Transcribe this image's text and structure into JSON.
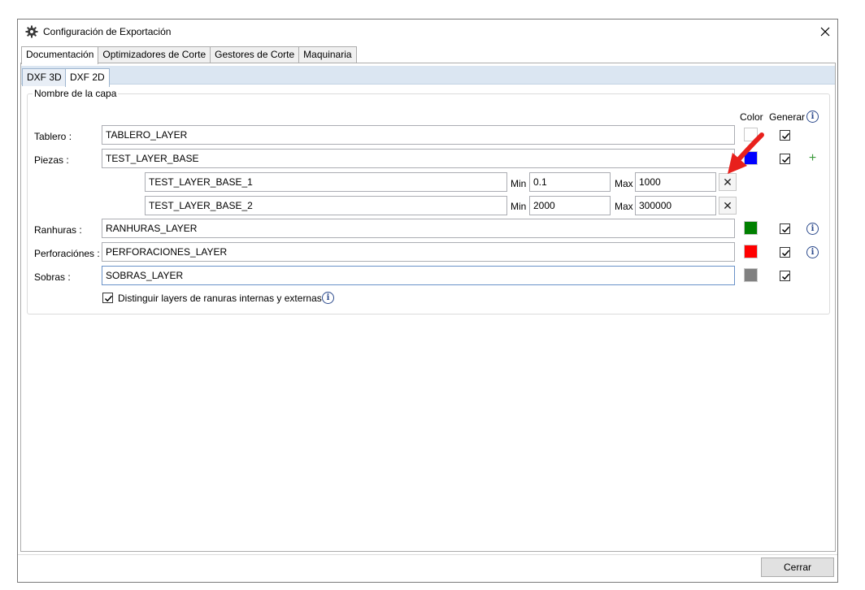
{
  "window": {
    "title": "Configuración de Exportación",
    "close_icon": "close-icon",
    "app_icon": "gear-icon"
  },
  "tabs": [
    {
      "label": "Documentación",
      "active": true
    },
    {
      "label": "Optimizadores de Corte",
      "active": false
    },
    {
      "label": "Gestores de Corte",
      "active": false
    },
    {
      "label": "Maquinaria",
      "active": false
    }
  ],
  "subtabs": [
    {
      "label": "DXF 3D",
      "active": false
    },
    {
      "label": "DXF 2D",
      "active": true
    }
  ],
  "group": {
    "title": "Nombre de la capa",
    "header_color": "Color",
    "header_generar": "Generar"
  },
  "rows": {
    "tablero": {
      "label": "Tablero :",
      "value": "TABLERO_LAYER",
      "color": "#ffffff",
      "generar": true
    },
    "piezas": {
      "label": "Piezas :",
      "value": "TEST_LAYER_BASE",
      "color": "#0000ff",
      "generar": true
    },
    "ranhuras": {
      "label": "Ranhuras :",
      "value": "RANHURAS_LAYER",
      "color": "#008000",
      "generar": true
    },
    "perforaciones": {
      "label": "Perforaciónes :",
      "value": "PERFORACIONES_LAYER",
      "color": "#ff0000",
      "generar": true
    },
    "sobras": {
      "label": "Sobras :",
      "value": "SOBRAS_LAYER",
      "color": "#808080",
      "generar": true
    }
  },
  "sublayers": [
    {
      "value": "TEST_LAYER_BASE_1",
      "min_label": "Min",
      "min": "0.1",
      "max_label": "Max",
      "max": "1000"
    },
    {
      "value": "TEST_LAYER_BASE_2",
      "min_label": "Min",
      "min": "2000",
      "max_label": "Max",
      "max": "300000"
    }
  ],
  "distinguish": {
    "label": "Distinguir layers de ranuras internas y externas",
    "checked": true
  },
  "footer": {
    "close_label": "Cerrar"
  },
  "glyphs": {
    "info": "i",
    "plus": "+",
    "remove": "✕"
  },
  "accent_arrow_color": "#e8201c"
}
